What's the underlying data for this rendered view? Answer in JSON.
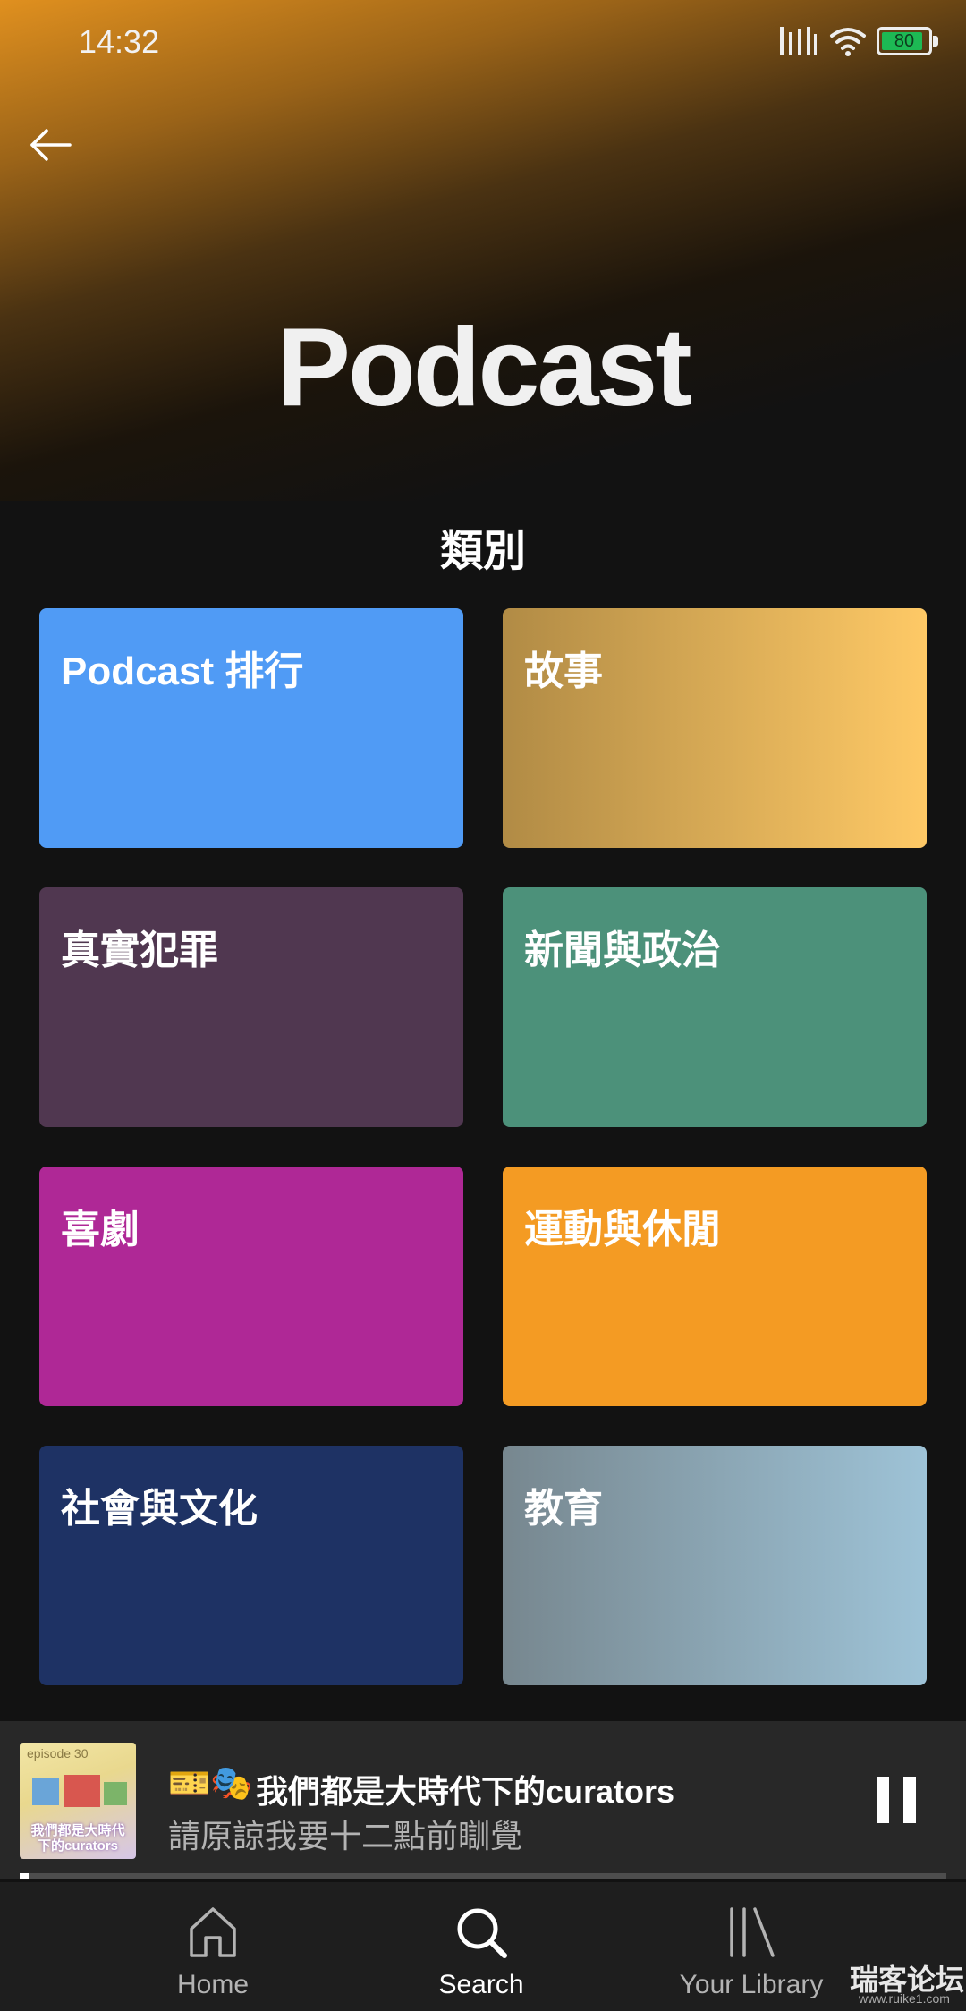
{
  "status_bar": {
    "time": "14:32",
    "battery": "80"
  },
  "header": {
    "title": "Podcast"
  },
  "section": {
    "title": "類別"
  },
  "categories": [
    {
      "label": "Podcast 排行",
      "color": "#509bf5",
      "color_end": "#509bf5"
    },
    {
      "label": "故事",
      "color": "#b18b45",
      "color_end": "#fec966"
    },
    {
      "label": "真實犯罪",
      "color": "#503750",
      "color_end": "#503750"
    },
    {
      "label": "新聞與政治",
      "color": "#4c917a",
      "color_end": "#4c917a"
    },
    {
      "label": "喜劇",
      "color": "#af2896",
      "color_end": "#af2896"
    },
    {
      "label": "運動與休閒",
      "color": "#f49b23",
      "color_end": "#f49b23"
    },
    {
      "label": "社會與文化",
      "color": "#1e3264",
      "color_end": "#1e3264"
    },
    {
      "label": "教育",
      "color": "#77878f",
      "color_end": "#9ec3d7"
    }
  ],
  "now_playing": {
    "art_tag": "episode 30",
    "art_caption": "我們都是大時代下的curators",
    "emoji": "🎫🎭",
    "title": "我們都是大時代下的curators",
    "subtitle": "請原諒我要十二點前瞓覺",
    "progress": 0.01
  },
  "nav": {
    "home": "Home",
    "search": "Search",
    "library": "Your Library",
    "active": "search"
  },
  "watermark": {
    "text": "瑞客论坛",
    "sub": "www.ruike1.com"
  }
}
